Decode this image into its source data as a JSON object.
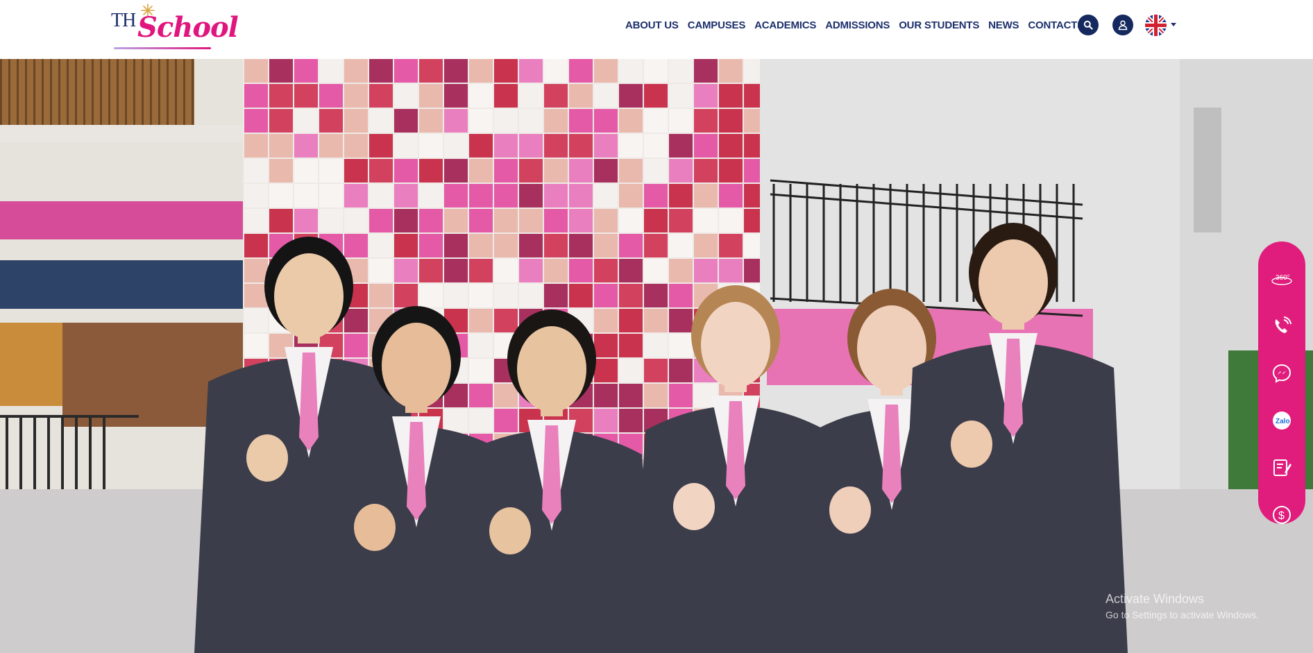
{
  "brand": {
    "logo_prefix": "TH",
    "logo_word": "School"
  },
  "nav": {
    "items": [
      {
        "label": "ABOUT US"
      },
      {
        "label": "CAMPUSES"
      },
      {
        "label": "ACADEMICS"
      },
      {
        "label": "ADMISSIONS"
      },
      {
        "label": "OUR STUDENTS"
      },
      {
        "label": "NEWS"
      },
      {
        "label": "CONTACTS"
      }
    ]
  },
  "header_icons": {
    "search": "search-icon",
    "account": "user-icon",
    "language": "uk-flag-icon"
  },
  "floating_bar": {
    "color": "#e01d7c",
    "items": [
      {
        "icon": "360-view-icon",
        "text": "360°"
      },
      {
        "icon": "phone-icon",
        "text": ""
      },
      {
        "icon": "messenger-icon",
        "text": ""
      },
      {
        "icon": "zalo-icon",
        "text": "Zalo"
      },
      {
        "icon": "registration-form-icon",
        "text": ""
      },
      {
        "icon": "tuition-fee-icon",
        "text": ""
      }
    ]
  },
  "watermark": {
    "title": "Activate Windows",
    "subtitle": "Go to Settings to activate Windows."
  },
  "colors": {
    "navy": "#1b2f6b",
    "pink": "#e0157e",
    "header_bg": "#ffffff"
  }
}
